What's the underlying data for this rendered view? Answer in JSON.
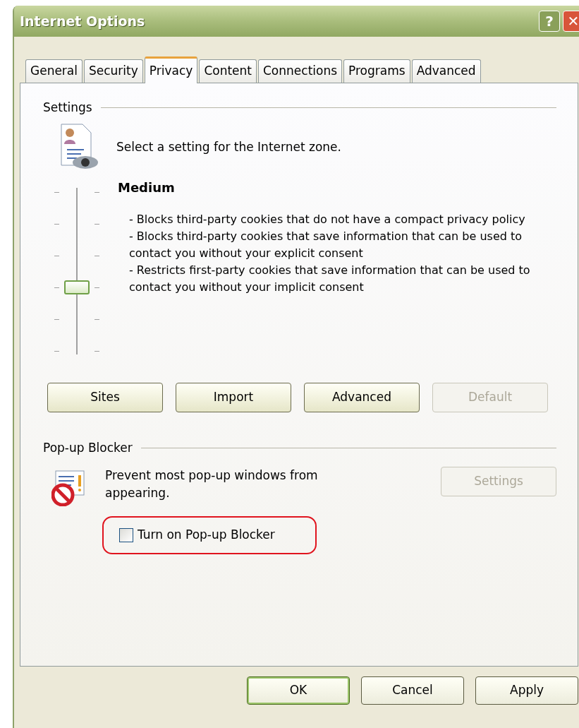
{
  "window": {
    "title": "Internet Options"
  },
  "title_buttons": [
    {
      "kind": "help",
      "label": "?"
    },
    {
      "kind": "close",
      "label": "✕"
    }
  ],
  "tabs": [
    {
      "label": "General",
      "selected": false
    },
    {
      "label": "Security",
      "selected": false
    },
    {
      "label": "Privacy",
      "selected": true
    },
    {
      "label": "Content",
      "selected": false
    },
    {
      "label": "Connections",
      "selected": false
    },
    {
      "label": "Programs",
      "selected": false
    },
    {
      "label": "Advanced",
      "selected": false
    }
  ],
  "settings": {
    "heading": "Settings",
    "prompt": "Select a setting for the Internet zone.",
    "slider": {
      "level": 0.4
    },
    "level_name": "Medium",
    "description": [
      "- Blocks third-party cookies that do not have a compact privacy policy",
      "- Blocks third-party cookies that save information that can be used to contact you without your explicit consent",
      "- Restricts first-party cookies that save information that can be used to contact you without your implicit consent"
    ],
    "buttons": [
      {
        "label": "Sites",
        "disabled": false
      },
      {
        "label": "Import",
        "disabled": false
      },
      {
        "label": "Advanced",
        "disabled": false
      },
      {
        "label": "Default",
        "disabled": true
      }
    ]
  },
  "popup_blocker": {
    "heading": "Pop-up Blocker",
    "text": "Prevent most pop-up windows from appearing.",
    "settings_button": {
      "label": "Settings",
      "disabled": true
    },
    "checkbox": {
      "label": "Turn on Pop-up Blocker",
      "checked": false,
      "highlighted": true
    }
  },
  "footer_buttons": [
    {
      "label": "OK",
      "default": true
    },
    {
      "label": "Cancel",
      "default": false
    },
    {
      "label": "Apply",
      "default": false
    }
  ]
}
